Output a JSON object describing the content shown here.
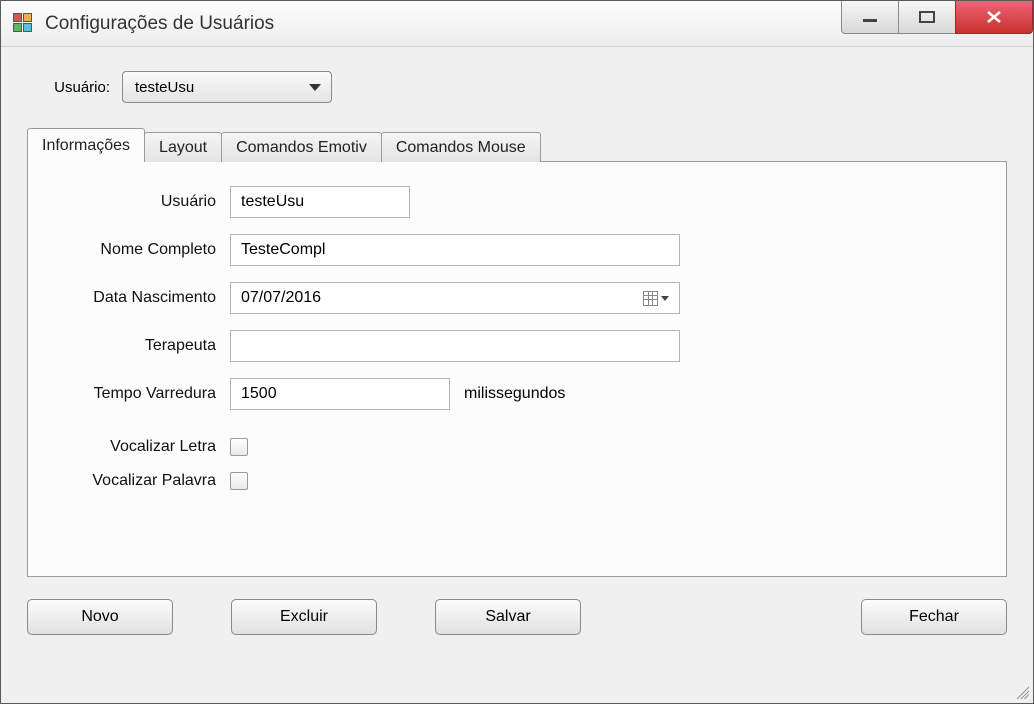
{
  "window": {
    "title": "Configurações de Usuários"
  },
  "top": {
    "usuario_label": "Usuário:",
    "usuario_selected": "testeUsu"
  },
  "tabs": {
    "informacoes": "Informações",
    "layout": "Layout",
    "comandos_emotiv": "Comandos Emotiv",
    "comandos_mouse": "Comandos Mouse"
  },
  "form": {
    "usuario_label": "Usuário",
    "usuario_value": "testeUsu",
    "nome_completo_label": "Nome Completo",
    "nome_completo_value": "TesteCompl",
    "data_nasc_label": "Data Nascimento",
    "data_nasc_value": "07/07/2016",
    "terapeuta_label": "Terapeuta",
    "terapeuta_value": "",
    "tempo_varredura_label": "Tempo Varredura",
    "tempo_varredura_value": "1500",
    "tempo_varredura_unit": "milissegundos",
    "vocalizar_letra_label": "Vocalizar Letra",
    "vocalizar_palavra_label": "Vocalizar Palavra"
  },
  "buttons": {
    "novo": "Novo",
    "excluir": "Excluir",
    "salvar": "Salvar",
    "fechar": "Fechar"
  }
}
